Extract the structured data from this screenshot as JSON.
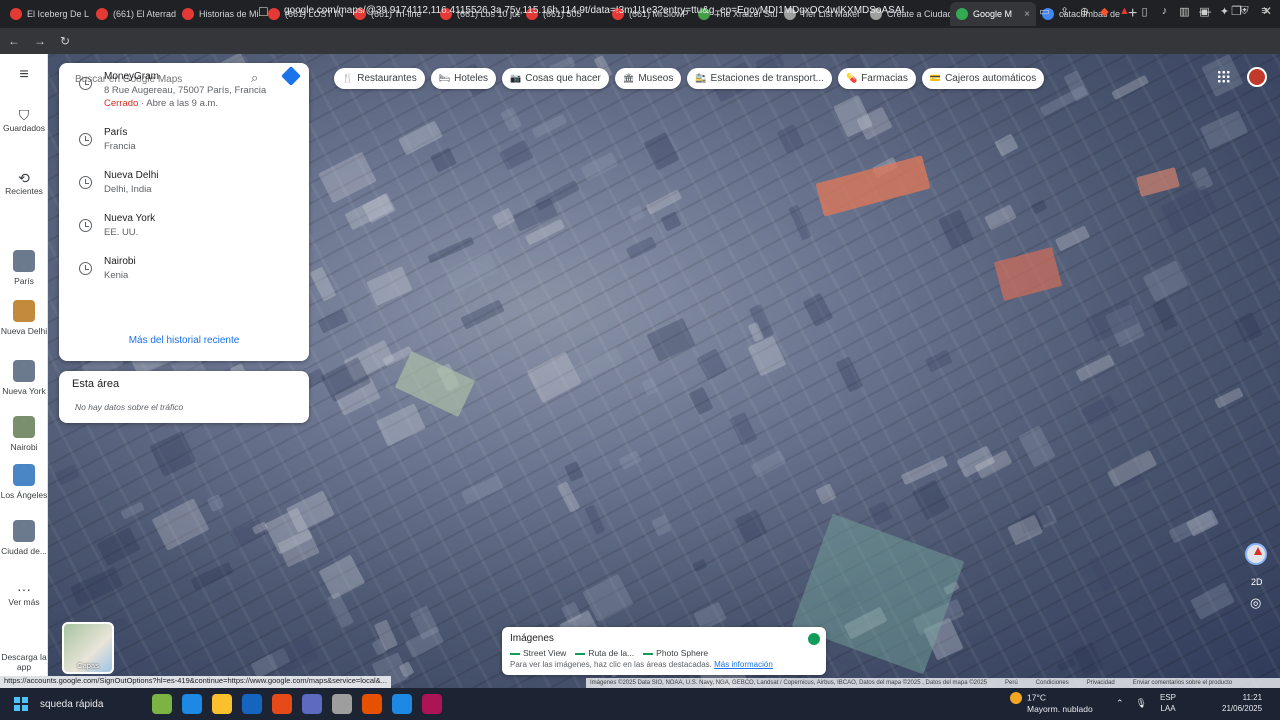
{
  "browser": {
    "tabs": [
      {
        "label": "El Iceberg De L",
        "color": "#e53935"
      },
      {
        "label": "(661) El Aterrad",
        "color": "#e53935"
      },
      {
        "label": "Historias de Mi",
        "color": "#e53935"
      },
      {
        "label": "(661) LOST IN",
        "color": "#e53935"
      },
      {
        "label": "(661) Tri-line",
        "color": "#e53935"
      },
      {
        "label": "(661) Los 10 jue",
        "color": "#e53935"
      },
      {
        "label": "(661) 505",
        "color": "#e53935"
      },
      {
        "label": "(661) MrSlowP",
        "color": "#e53935"
      },
      {
        "label": "The Xraizer Stu",
        "color": "#43a047"
      },
      {
        "label": "Tier List Maker",
        "color": "#9e9e9e"
      },
      {
        "label": "Create a Ciudad",
        "color": "#9e9e9e"
      },
      {
        "label": "Google M",
        "color": "#34a853",
        "active": true
      },
      {
        "label": "catacumbas de",
        "color": "#4285f4"
      }
    ],
    "tab_close": "×",
    "new_tab": "+",
    "window_controls": [
      "—",
      "❐",
      "✕"
    ],
    "nav": {
      "back": "←",
      "forward": "→",
      "reload": "↻",
      "bookmark": "☐"
    },
    "url": "google.com/maps/@39.9174112,116.4115526,3a,75y,115.16h,114.9t/data=!3m1!1e3?entry=ttu&g_ep=EgoyMDI1MDgxOC4wIKXMDSoASAFQA...",
    "status_url": "https://accounts.google.com/SignOutOptions?hl=es-419&continue=https://www.google.com/maps&service=local&..."
  },
  "rail": {
    "menu_icon": "≡",
    "saved_label": "Guardados",
    "recent_label": "Recientes",
    "places": [
      {
        "label": "París",
        "color": "#6b7a8f"
      },
      {
        "label": "Nueva Delhi",
        "color": "#c28a3a"
      },
      {
        "label": "Nueva York",
        "color": "#6b7a8f"
      },
      {
        "label": "Nairobi",
        "color": "#7a8f6b"
      },
      {
        "label": "Los Ángeles",
        "color": "#4a86c5"
      },
      {
        "label": "Ciudad de...",
        "color": "#6b7a8f"
      }
    ],
    "more_label": "Ver más",
    "download_label": "Descarga la app"
  },
  "search": {
    "placeholder": "Buscar en Google Maps",
    "history": [
      {
        "title": "MoneyGram",
        "sub": "8 Rue Augereau, 75007 París, Francia",
        "closed": "Cerrado",
        "hours": " · Abre a las 9 a.m."
      },
      {
        "title": "París",
        "sub": "Francia"
      },
      {
        "title": "Nueva Delhi",
        "sub": "Delhi, India"
      },
      {
        "title": "Nueva York",
        "sub": "EE. UU."
      },
      {
        "title": "Nairobi",
        "sub": "Kenia"
      }
    ],
    "more_history": "Más del historial reciente"
  },
  "area": {
    "title": "Esta área",
    "traffic": "No hay datos sobre el tráfico"
  },
  "chips": [
    {
      "icon": "🍴",
      "label": "Restaurantes"
    },
    {
      "icon": "🛏",
      "label": "Hoteles"
    },
    {
      "icon": "📷",
      "label": "Cosas que hacer"
    },
    {
      "icon": "🏛",
      "label": "Museos"
    },
    {
      "icon": "🚉",
      "label": "Estaciones de transport..."
    },
    {
      "icon": "💊",
      "label": "Farmacias"
    },
    {
      "icon": "💳",
      "label": "Cajeros automáticos"
    }
  ],
  "controls": {
    "tilt": "2D",
    "locate": "◎"
  },
  "layers": {
    "label": "Capas"
  },
  "imagery": {
    "title": "Imágenes",
    "legend": [
      "Street View",
      "Ruta de la...",
      "Photo Sphere"
    ],
    "help": "Para ver las imágenes, haz clic en las áreas destacadas. ",
    "help_link": "Más información"
  },
  "attribution": {
    "data": "Imágenes ©2025 Data SIO, NOAA, U.S. Navy, NGA, GEBCO, Landsat / Copernicus, Airbus, IBCAO, Datos del mapa ©2025 , Datos del mapa ©2025",
    "links": [
      "Perú",
      "Condiciones",
      "Privacidad",
      "Enviar comentarios sobre el producto"
    ]
  },
  "taskbar": {
    "search": "squeda rápida",
    "apps": [
      "#7cb342",
      "#1e88e5",
      "#fbc02d",
      "#1565c0",
      "#e64a19",
      "#5c6bc0",
      "#9e9e9e",
      "#e65100",
      "#1e88e5",
      "#ad1457"
    ],
    "weather_temp": "17°C",
    "weather_desc": "Mayorm. nublado",
    "lang_top": "ESP",
    "lang_bottom": "LAA",
    "time": "11:21",
    "date": "21/06/2025"
  }
}
